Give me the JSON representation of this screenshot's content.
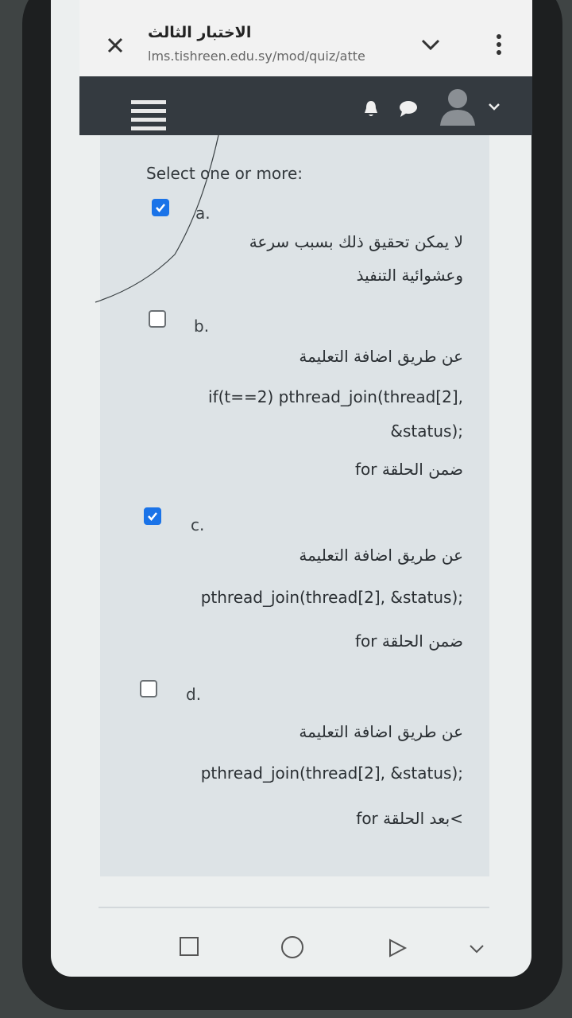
{
  "browser": {
    "title": "الاختبار الثالث",
    "url": "lms.tishreen.edu.sy/mod/quiz/atte"
  },
  "navbar": {
    "menu_icon": "hamburger-icon",
    "icons": [
      "bell-icon",
      "chat-icon",
      "avatar-icon",
      "chevron-down-icon"
    ]
  },
  "question": {
    "prompt": "Select one or more:",
    "options": [
      {
        "letter": "a.",
        "checked": true,
        "lines": [
          "لا يمكن تحقيق ذلك بسبب سرعة",
          "وعشوائية التنفيذ"
        ]
      },
      {
        "letter": "b.",
        "checked": false,
        "lines": [
          "عن طريق اضافة التعليمة",
          "if(t==2) pthread_join(thread[2],",
          "&status);",
          "ضمن الحلقة for"
        ]
      },
      {
        "letter": "c.",
        "checked": true,
        "lines": [
          "عن طريق اضافة التعليمة",
          "pthread_join(thread[2], &status);",
          "ضمن الحلقة for"
        ]
      },
      {
        "letter": "d.",
        "checked": false,
        "lines": [
          "عن طريق اضافة التعليمة",
          "pthread_join(thread[2], &status);",
          ">بعد الحلقة for"
        ]
      }
    ]
  },
  "colors": {
    "navbar": "#343a40",
    "checkbox_checked": "#1a73e8",
    "content_bg": "#dde3e6"
  }
}
